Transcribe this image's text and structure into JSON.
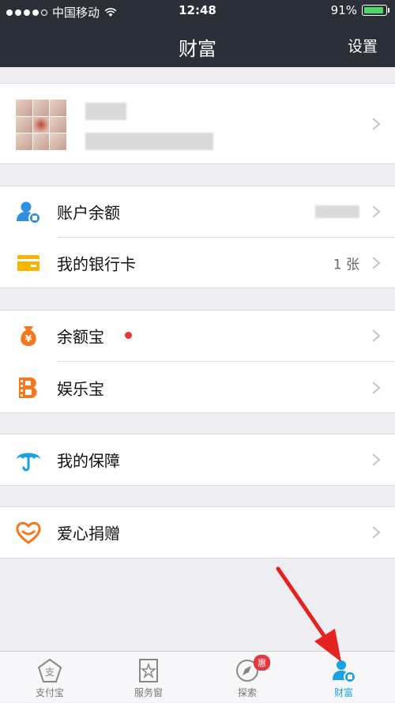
{
  "status_bar": {
    "carrier": "中国移动",
    "time": "12:48",
    "battery": "91%",
    "battery_level": 0.91
  },
  "nav": {
    "title": "财富",
    "settings_label": "设置"
  },
  "profile": {
    "name": "",
    "subtitle": ""
  },
  "rows": {
    "balance": {
      "label": "账户余额",
      "value": ""
    },
    "bank_card": {
      "label": "我的银行卡",
      "value": "1 张"
    },
    "yuebao": {
      "label": "余额宝"
    },
    "yulebao": {
      "label": "娱乐宝"
    },
    "insurance": {
      "label": "我的保障"
    },
    "donation": {
      "label": "爱心捐赠"
    }
  },
  "tabbar": {
    "tabs": [
      {
        "label": "支付宝",
        "icon": "alipay-icon"
      },
      {
        "label": "服务窗",
        "icon": "service-window-icon"
      },
      {
        "label": "探索",
        "icon": "explore-icon",
        "badge": "惠"
      },
      {
        "label": "财富",
        "icon": "wealth-icon",
        "active": true
      }
    ]
  },
  "colors": {
    "nav_bg": "#2b2f37",
    "accent_blue": "#1ba1e2",
    "orange": "#f5781e",
    "yellow": "#f8b500",
    "red_dot": "#e4393c",
    "arrow": "#e3231f"
  }
}
